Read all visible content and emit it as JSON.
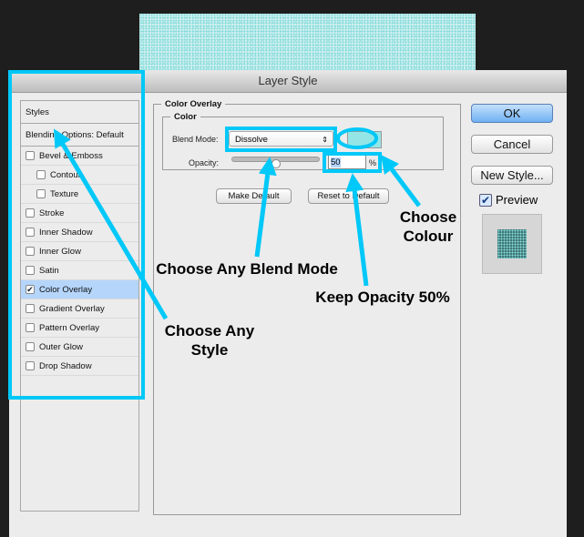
{
  "window": {
    "title": "Layer Style"
  },
  "sidebar": {
    "header": "Styles",
    "blending": "Blending Options: Default",
    "items": [
      {
        "label": "Bevel & Emboss",
        "checked": false
      },
      {
        "label": "Contour",
        "checked": false
      },
      {
        "label": "Texture",
        "checked": false
      },
      {
        "label": "Stroke",
        "checked": false
      },
      {
        "label": "Inner Shadow",
        "checked": false
      },
      {
        "label": "Inner Glow",
        "checked": false
      },
      {
        "label": "Satin",
        "checked": false
      },
      {
        "label": "Color Overlay",
        "checked": true
      },
      {
        "label": "Gradient Overlay",
        "checked": false
      },
      {
        "label": "Pattern Overlay",
        "checked": false
      },
      {
        "label": "Outer Glow",
        "checked": false
      },
      {
        "label": "Drop Shadow",
        "checked": false
      }
    ]
  },
  "panel": {
    "title": "Color Overlay",
    "group": "Color",
    "blend_label": "Blend Mode:",
    "blend_value": "Dissolve",
    "swatch_color": "#94e6e6",
    "opacity_label": "Opacity:",
    "opacity_value": "50",
    "opacity_unit": "%",
    "opacity_percent": 50,
    "make_default": "Make Default",
    "reset_default": "Reset to Default"
  },
  "buttons": {
    "ok": "OK",
    "cancel": "Cancel",
    "new_style": "New Style...",
    "preview": "Preview",
    "preview_checked": true
  },
  "annotations": {
    "style": "Choose Any Style",
    "blend": "Choose Any Blend Mode",
    "opacity": "Keep Opacity 50%",
    "colour": "Choose Colour",
    "color": "#00c8f8"
  }
}
